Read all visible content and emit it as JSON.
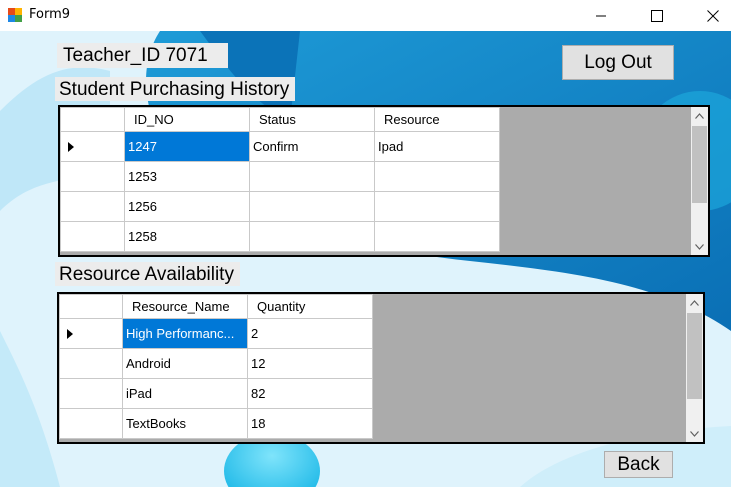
{
  "window": {
    "title": "Form9",
    "minimize_icon": "minimize-icon",
    "maximize_icon": "maximize-icon",
    "close_icon": "close-icon"
  },
  "header": {
    "teacher_label": "Teacher_ID  7071",
    "logout_label": "Log Out"
  },
  "history": {
    "title": "Student Purchasing History",
    "columns": [
      "ID_NO",
      "Status",
      "Resource"
    ],
    "rows": [
      [
        "1247",
        "Confirm",
        "Ipad"
      ],
      [
        "1253",
        "",
        ""
      ],
      [
        "1256",
        "",
        ""
      ],
      [
        "1258",
        "",
        ""
      ]
    ]
  },
  "resources": {
    "title": "Resource Availability",
    "columns": [
      "Resource_Name",
      "Quantity"
    ],
    "rows": [
      [
        "High Performanc...",
        "2"
      ],
      [
        "Android",
        "12"
      ],
      [
        "iPad",
        "82"
      ],
      [
        "TextBooks",
        "18"
      ]
    ]
  },
  "footer": {
    "back_label": "Back"
  },
  "colors": {
    "selection": "#0078d7",
    "background_blue": "#0a85c8",
    "light_cyan": "#2cc4ea"
  }
}
